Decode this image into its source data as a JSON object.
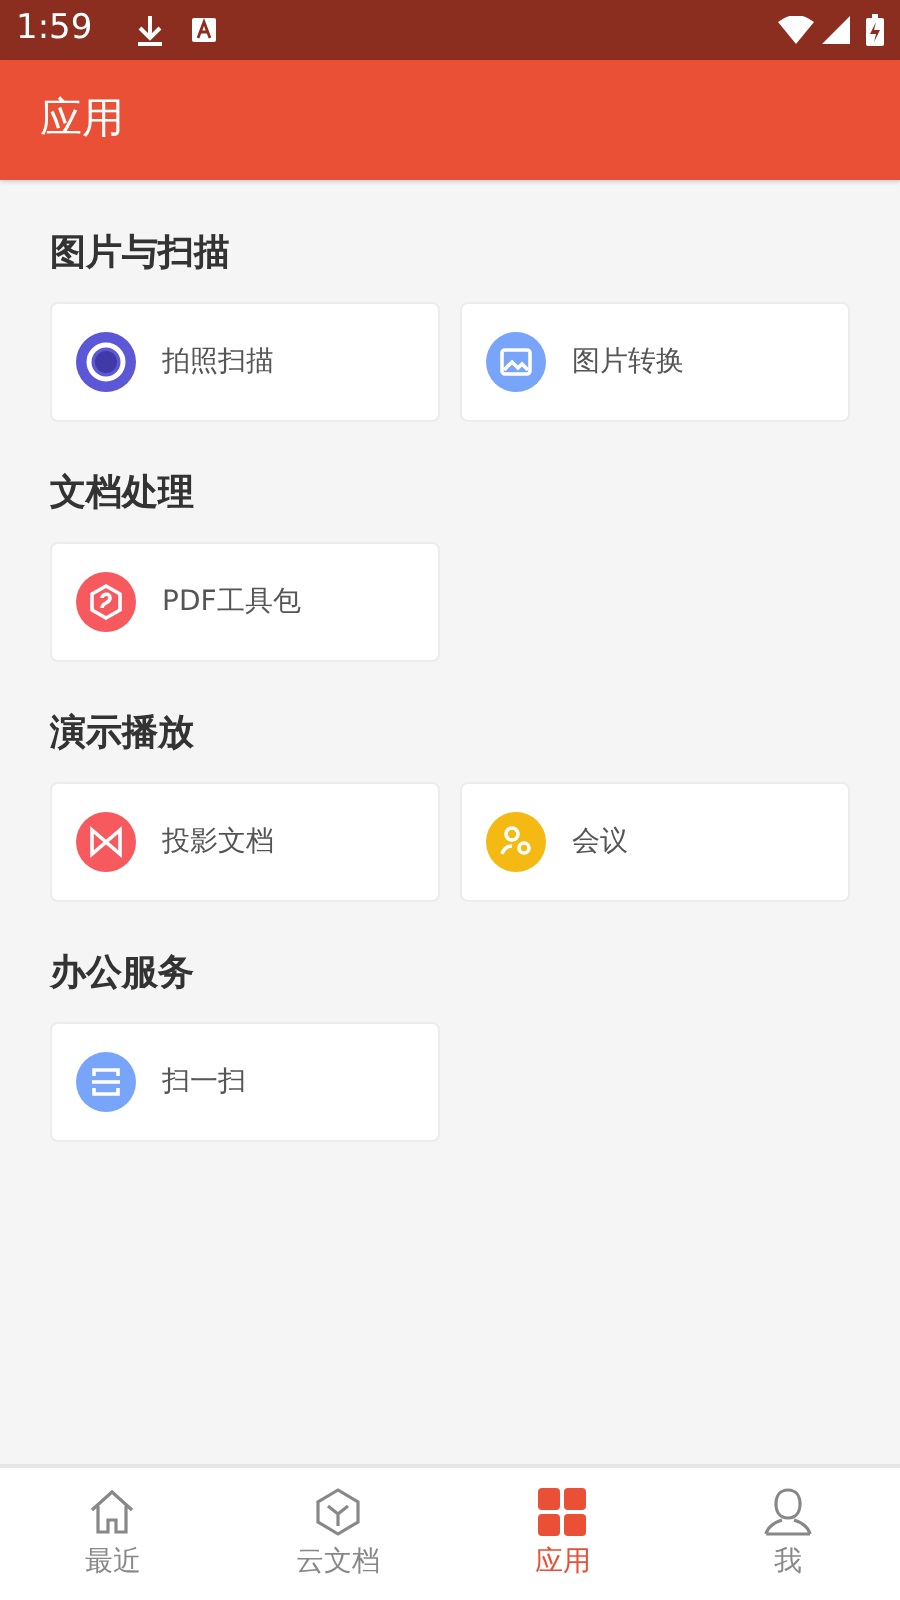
{
  "status_bar": {
    "time": "1:59"
  },
  "header": {
    "title": "应用"
  },
  "sections": [
    {
      "title": "图片与扫描",
      "items": [
        {
          "label": "拍照扫描",
          "kind": "camera",
          "color": "#5b57d6"
        },
        {
          "label": "图片转换",
          "kind": "image",
          "color": "#78a4fa"
        }
      ]
    },
    {
      "title": "文档处理",
      "items": [
        {
          "label": "PDF工具包",
          "kind": "pdf",
          "color": "#f65a5f"
        }
      ]
    },
    {
      "title": "演示播放",
      "items": [
        {
          "label": "投影文档",
          "kind": "projection",
          "color": "#f65a5f"
        },
        {
          "label": "会议",
          "kind": "meeting",
          "color": "#f5b914"
        }
      ]
    },
    {
      "title": "办公服务",
      "items": [
        {
          "label": "扫一扫",
          "kind": "scan",
          "color": "#78a4fa"
        }
      ]
    }
  ],
  "bottom_nav": [
    {
      "label": "最近",
      "kind": "home",
      "selected": false
    },
    {
      "label": "云文档",
      "kind": "cube",
      "selected": false
    },
    {
      "label": "应用",
      "kind": "apps",
      "selected": true
    },
    {
      "label": "我",
      "kind": "person",
      "selected": false
    }
  ]
}
